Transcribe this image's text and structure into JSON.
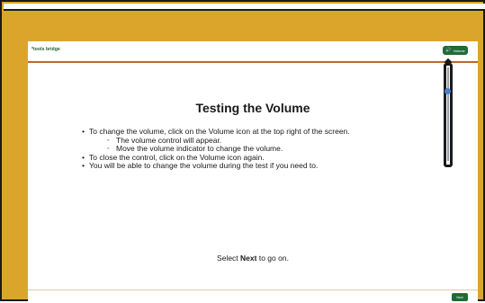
{
  "header": {
    "logo_text": "*tools bridge",
    "volume_button_label": "Volume",
    "volume_icon": "speaker-icon"
  },
  "volume_control": {
    "level": 0.75
  },
  "main": {
    "title": "Testing the Volume",
    "bullets": [
      {
        "text": "To change the volume, click on the Volume icon at the top right of the screen."
      },
      {
        "text": "The volume control will appear.",
        "sub": true
      },
      {
        "text": "Move the volume indicator to change the volume.",
        "sub": true
      },
      {
        "text": "To close the control, click on the Volume icon again."
      },
      {
        "text": "You will be able to change the volume during the test if you need to."
      }
    ],
    "prompt_before": "Select ",
    "prompt_bold": "Next",
    "prompt_after": " to go on."
  },
  "footer": {
    "next_label": "Next"
  },
  "colors": {
    "frame_gold": "#dba52c",
    "accent_green": "#1f6b35",
    "header_rule": "#b8692a",
    "slider_knob": "#4a7fd0"
  }
}
